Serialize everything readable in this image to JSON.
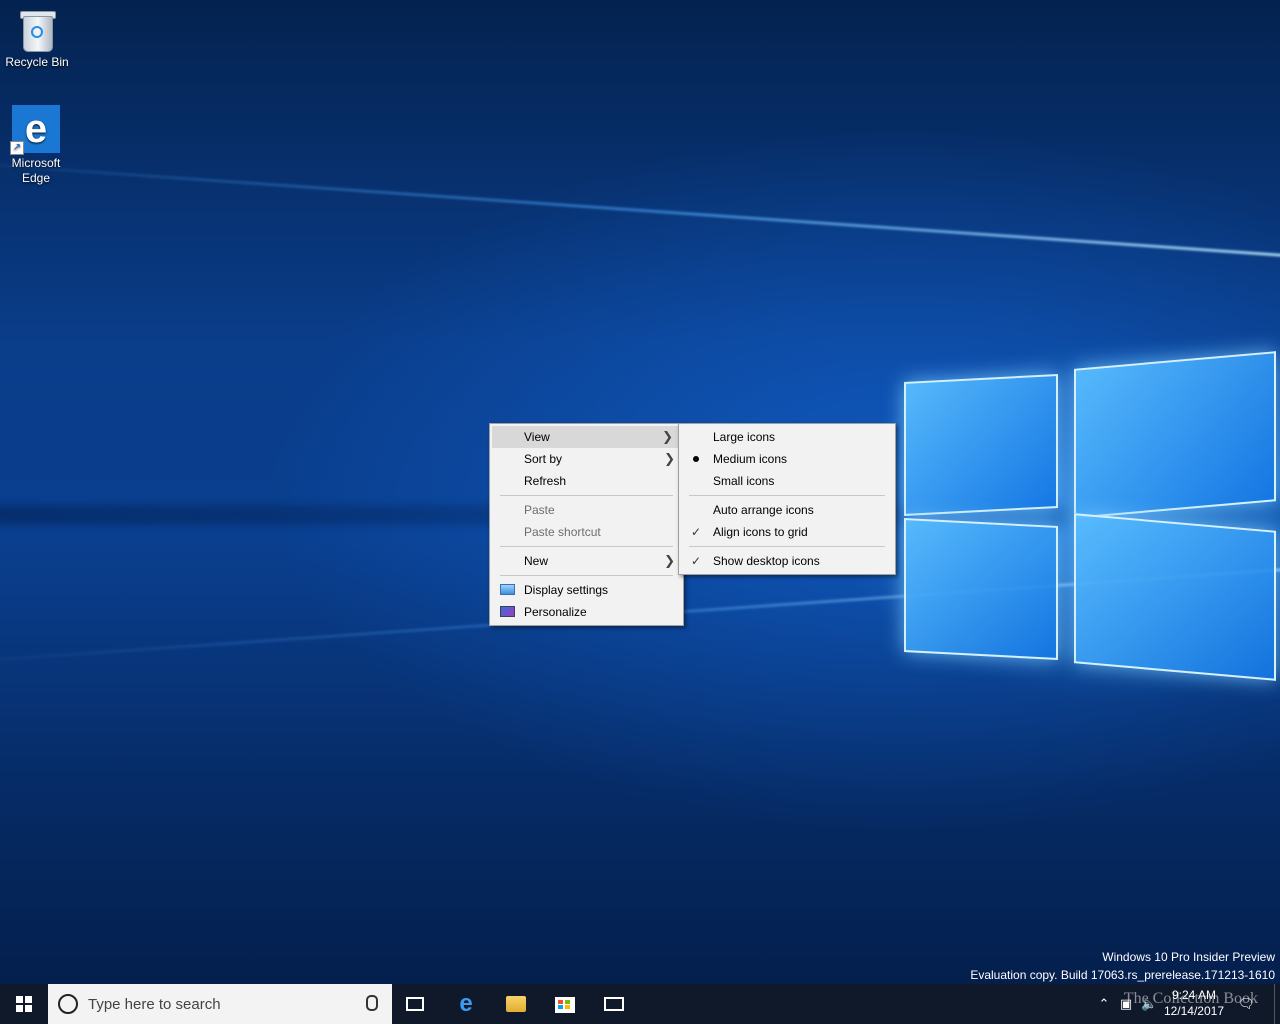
{
  "desktop": {
    "icons": [
      {
        "label": "Recycle Bin",
        "icon": "recycle-bin-icon"
      },
      {
        "label": "Microsoft Edge",
        "icon": "edge-icon"
      }
    ]
  },
  "context_menu": {
    "items": {
      "view": "View",
      "sort_by": "Sort by",
      "refresh": "Refresh",
      "paste": "Paste",
      "paste_shortcut": "Paste shortcut",
      "new": "New",
      "display_settings": "Display settings",
      "personalize": "Personalize"
    },
    "highlighted": "View"
  },
  "view_submenu": {
    "large_icons": "Large icons",
    "medium_icons": "Medium icons",
    "small_icons": "Small icons",
    "auto_arrange": "Auto arrange icons",
    "align_to_grid": "Align icons to grid",
    "show_desktop_icons": "Show desktop icons",
    "selected_size": "Medium icons",
    "checked": [
      "Align icons to grid",
      "Show desktop icons"
    ]
  },
  "watermark": {
    "line1": "Windows 10 Pro Insider Preview",
    "line2": "Evaluation copy. Build 17063.rs_prerelease.171213-1610"
  },
  "taskbar": {
    "search_placeholder": "Type here to search",
    "pinned": [
      "task-view-icon",
      "edge-icon",
      "file-explorer-icon",
      "store-icon",
      "mail-icon"
    ],
    "clock": {
      "time": "9:24 AM",
      "date": "12/14/2017"
    },
    "overlay_text": "The Collection Book"
  },
  "colors": {
    "taskbar": "#10192a",
    "menu_bg": "#f2f2f2",
    "menu_highlight": "#d8d8d8",
    "accent": "#1a78d4"
  }
}
